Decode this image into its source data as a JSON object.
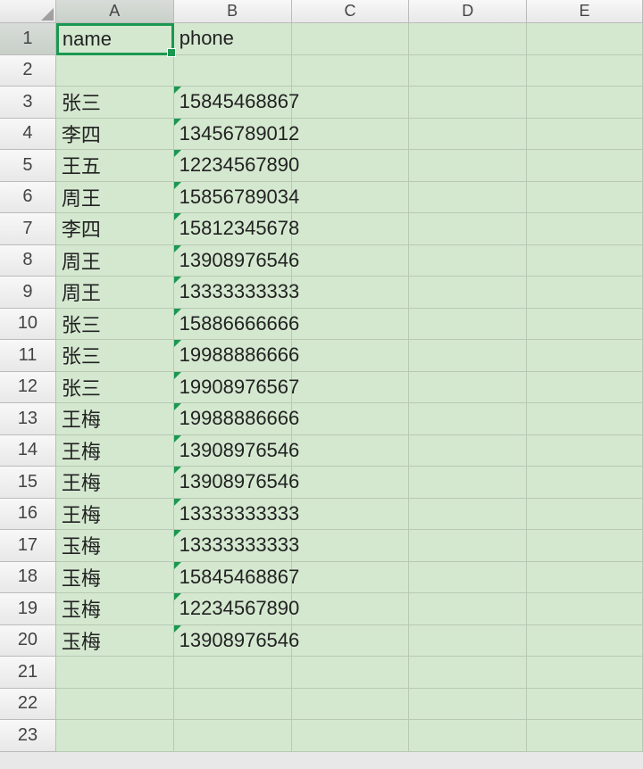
{
  "columns": [
    "A",
    "B",
    "C",
    "D",
    "E"
  ],
  "active_cell": {
    "row": 1,
    "col": "A"
  },
  "header_row": {
    "A": "name",
    "B": "phone"
  },
  "rows": [
    {
      "n": 1,
      "A": "name",
      "B": "phone",
      "text_marker_B": false
    },
    {
      "n": 2,
      "A": "",
      "B": ""
    },
    {
      "n": 3,
      "A": "张三",
      "B": "15845468867",
      "text_marker_B": true
    },
    {
      "n": 4,
      "A": "李四",
      "B": "13456789012",
      "text_marker_B": true
    },
    {
      "n": 5,
      "A": "王五",
      "B": "12234567890",
      "text_marker_B": true
    },
    {
      "n": 6,
      "A": "周王",
      "B": "15856789034",
      "text_marker_B": true
    },
    {
      "n": 7,
      "A": "李四",
      "B": "15812345678",
      "text_marker_B": true
    },
    {
      "n": 8,
      "A": "周王",
      "B": "13908976546",
      "text_marker_B": true
    },
    {
      "n": 9,
      "A": "周王",
      "B": "13333333333",
      "text_marker_B": true
    },
    {
      "n": 10,
      "A": "张三",
      "B": "15886666666",
      "text_marker_B": true
    },
    {
      "n": 11,
      "A": "张三",
      "B": "19988886666",
      "text_marker_B": true
    },
    {
      "n": 12,
      "A": "张三",
      "B": "19908976567",
      "text_marker_B": true
    },
    {
      "n": 13,
      "A": "王梅",
      "B": "19988886666",
      "text_marker_B": true
    },
    {
      "n": 14,
      "A": "王梅",
      "B": "13908976546",
      "text_marker_B": true
    },
    {
      "n": 15,
      "A": "王梅",
      "B": "13908976546",
      "text_marker_B": true
    },
    {
      "n": 16,
      "A": "王梅",
      "B": "13333333333",
      "text_marker_B": true
    },
    {
      "n": 17,
      "A": "玉梅",
      "B": "13333333333",
      "text_marker_B": true
    },
    {
      "n": 18,
      "A": "玉梅",
      "B": "15845468867",
      "text_marker_B": true
    },
    {
      "n": 19,
      "A": "玉梅",
      "B": "12234567890",
      "text_marker_B": true
    },
    {
      "n": 20,
      "A": "玉梅",
      "B": "13908976546",
      "text_marker_B": true
    },
    {
      "n": 21,
      "A": "",
      "B": ""
    },
    {
      "n": 22,
      "A": "",
      "B": ""
    },
    {
      "n": 23,
      "A": "",
      "B": ""
    }
  ]
}
